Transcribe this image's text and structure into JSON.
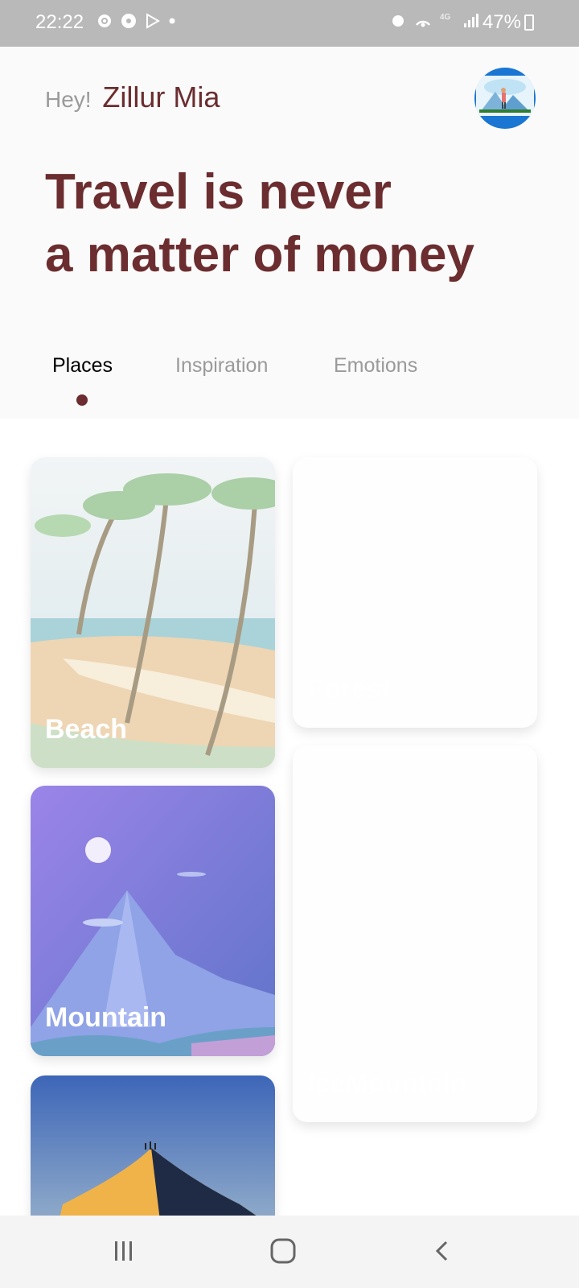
{
  "status_bar": {
    "time": "22:22",
    "battery": "47%",
    "icons_left": [
      "gear-icon",
      "soccer-icon",
      "play-store-icon",
      "dot-icon"
    ],
    "icons_right": [
      "alarm-icon",
      "hotspot-icon",
      "4g-icon",
      "signal-icon"
    ]
  },
  "header": {
    "greeting": "Hey!",
    "user_name": "Zillur Mia",
    "headline_line1": "Travel is never",
    "headline_line2": "a matter of money"
  },
  "tabs": [
    {
      "label": "Places",
      "active": true
    },
    {
      "label": "Inspiration",
      "active": false
    },
    {
      "label": "Emotions",
      "active": false
    }
  ],
  "places": [
    {
      "label": "Beach"
    },
    {
      "label": "Forest"
    },
    {
      "label": "Mountain"
    },
    {
      "label": "IceMountain"
    },
    {
      "label": ""
    }
  ],
  "nav": {
    "recent": "recents-icon",
    "home": "home-icon",
    "back": "back-icon"
  },
  "colors": {
    "accent": "#6b2d2f",
    "status_bar": "#b9b9b9"
  }
}
